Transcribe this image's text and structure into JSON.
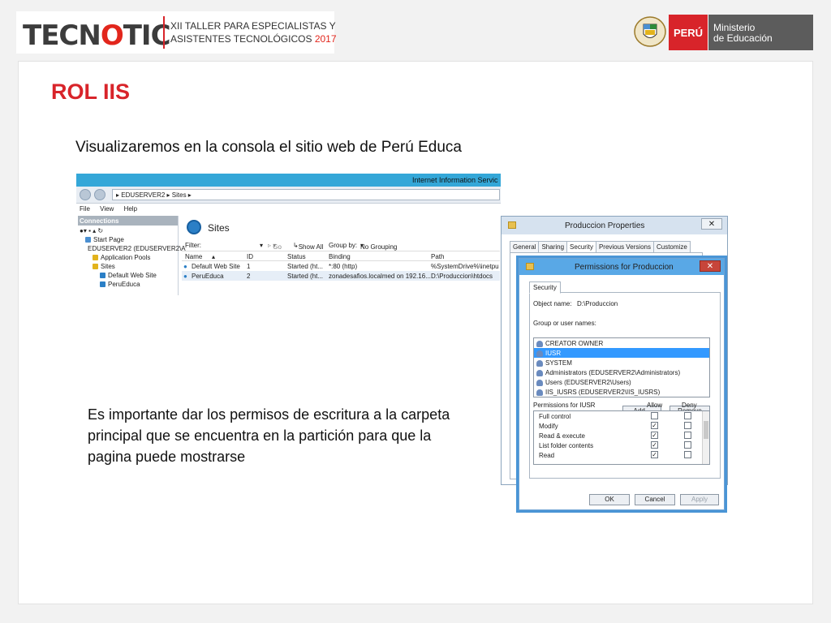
{
  "header": {
    "logo_pre": "TECN",
    "logo_accent": "O",
    "logo_post": "TIC",
    "event_line1": "XII TALLER PARA  ESPECIALISTAS  Y",
    "event_line2": "ASISTENTES TECNOLÓGICOS",
    "event_year": "2017",
    "country": "PERÚ",
    "ministry_line1": "Ministerio",
    "ministry_line2": "de Educación"
  },
  "slide": {
    "title": "ROL IIS",
    "intro": "Visualizaremos en la consola el sitio web de Perú Educa",
    "body": "Es importante dar los permisos de escritura a la carpeta principal que se encuentra en la partición para que la pagina puede mostrarse"
  },
  "iis": {
    "window_title": "Internet Information Servic",
    "breadcrumb": "▸  EDUSERVER2  ▸  Sites  ▸",
    "menu": [
      "File",
      "View",
      "Help"
    ],
    "connections_label": "Connections",
    "tree": [
      {
        "label": "Start Page",
        "indent": 1
      },
      {
        "label": "EDUSERVER2 (EDUSERVER2\\A",
        "indent": 1
      },
      {
        "label": "Application Pools",
        "indent": 2
      },
      {
        "label": "Sites",
        "indent": 2
      },
      {
        "label": "Default Web Site",
        "indent": 3
      },
      {
        "label": "PeruEduca",
        "indent": 3
      }
    ],
    "sites_title": "Sites",
    "filter_label": "Filter:",
    "go_label": "Go",
    "show_all_label": "Show All",
    "group_by_label": "Group by:",
    "group_by_value": "No Grouping",
    "columns": [
      "Name",
      "ID",
      "Status",
      "Binding",
      "Path"
    ],
    "rows": [
      [
        "Default Web Site",
        "1",
        "Started (ht...",
        "*:80 (http)",
        "%SystemDrive%\\inetpu"
      ],
      [
        "PeruEduca",
        "2",
        "Started (ht...",
        "zonadesafios.localmed on 192.16...",
        "D:\\Produccion\\htdocs"
      ]
    ]
  },
  "props": {
    "title": "Produccion Properties",
    "tabs": [
      "General",
      "Sharing",
      "Security",
      "Previous Versions",
      "Customize"
    ],
    "active_tab": "Security"
  },
  "perms": {
    "title": "Permissions for Produccion",
    "tab": "Security",
    "object_name_label": "Object name:",
    "object_name_value": "D:\\Produccion",
    "group_label": "Group or user names:",
    "users": [
      "CREATOR OWNER",
      "IUSR",
      "SYSTEM",
      "Administrators (EDUSERVER2\\Administrators)",
      "Users (EDUSERVER2\\Users)",
      "IIS_IUSRS (EDUSERVER2\\IIS_IUSRS)"
    ],
    "selected_user": "IUSR",
    "add_label": "Add...",
    "remove_label": "Remove",
    "permissions_for_label": "Permissions for IUSR",
    "allow_label": "Allow",
    "deny_label": "Deny",
    "permissions": [
      {
        "name": "Full control",
        "allow": false,
        "deny": false
      },
      {
        "name": "Modify",
        "allow": true,
        "deny": false
      },
      {
        "name": "Read & execute",
        "allow": true,
        "deny": false
      },
      {
        "name": "List folder contents",
        "allow": true,
        "deny": false
      },
      {
        "name": "Read",
        "allow": true,
        "deny": false
      }
    ],
    "ok_label": "OK",
    "cancel_label": "Cancel",
    "apply_label": "Apply"
  }
}
